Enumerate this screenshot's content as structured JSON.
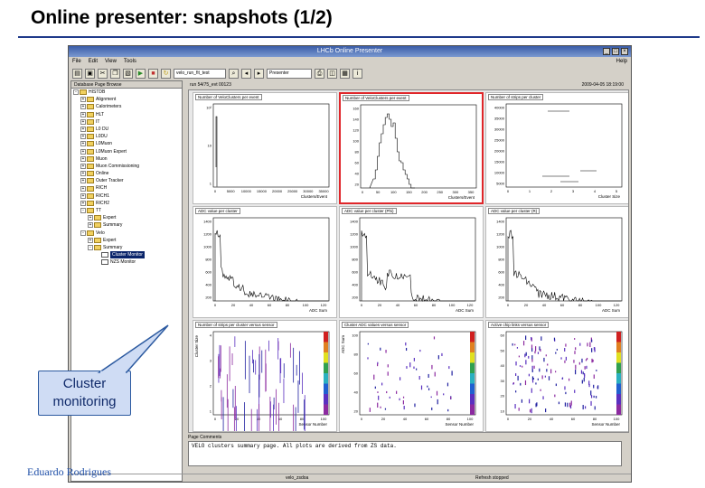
{
  "slide": {
    "title": "Online presenter: snapshots (1/2)",
    "callout": "Cluster monitoring",
    "footer": "Eduardo Rodrigues"
  },
  "window": {
    "title": "LHCb Online Presenter",
    "menu": [
      "File",
      "Edit",
      "View",
      "Tools"
    ],
    "help": "Help",
    "toolbar": {
      "partition_combo": "velo_run_fit_test",
      "mode_combo": "Presenter"
    },
    "info_left": "run 54/75_evt 00123",
    "info_right": "2009-04-05 18:19:00"
  },
  "tree": {
    "header": "Database Page Browse",
    "items": [
      {
        "label": "HISTDB",
        "exp": "-",
        "icon": "folder"
      },
      {
        "label": "Alignment",
        "exp": "+",
        "icon": "folder"
      },
      {
        "label": "Calorimeters",
        "exp": "+",
        "icon": "folder"
      },
      {
        "label": "HLT",
        "exp": "+",
        "icon": "folder"
      },
      {
        "label": "IT",
        "exp": "+",
        "icon": "folder"
      },
      {
        "label": "L0 DU",
        "exp": "+",
        "icon": "folder"
      },
      {
        "label": "L0DU",
        "exp": "+",
        "icon": "folder"
      },
      {
        "label": "L0Muon",
        "exp": "+",
        "icon": "folder"
      },
      {
        "label": "L0Muon Expert",
        "exp": "+",
        "icon": "folder"
      },
      {
        "label": "Muon",
        "exp": "+",
        "icon": "folder"
      },
      {
        "label": "Muon Commissioning",
        "exp": "+",
        "icon": "folder"
      },
      {
        "label": "Online",
        "exp": "+",
        "icon": "folder"
      },
      {
        "label": "Outer Tracker",
        "exp": "+",
        "icon": "folder"
      },
      {
        "label": "RICH",
        "exp": "+",
        "icon": "folder"
      },
      {
        "label": "RICH1",
        "exp": "+",
        "icon": "folder"
      },
      {
        "label": "RICH2",
        "exp": "+",
        "icon": "folder"
      },
      {
        "label": "TT",
        "exp": "-",
        "icon": "folder"
      },
      {
        "label": "Expert",
        "exp": "+",
        "icon": "folder"
      },
      {
        "label": "Summary",
        "exp": "+",
        "icon": "folder"
      },
      {
        "label": "Velo",
        "exp": "-",
        "icon": "folder"
      },
      {
        "label": "Expert",
        "exp": "+",
        "icon": "folder"
      },
      {
        "label": "Summary",
        "exp": "-",
        "icon": "folder"
      },
      {
        "label": "Cluster Monitor",
        "exp": "",
        "icon": "hist",
        "selected": true
      },
      {
        "label": "NZS Monitor",
        "exp": "",
        "icon": "hist"
      }
    ]
  },
  "plots": [
    {
      "title": "Number of VeloClusters per event",
      "xlabel": "Clusters/Event",
      "yticks": [
        "10²",
        "10",
        "1"
      ],
      "xticks": [
        "0",
        "5000",
        "10000",
        "15000",
        "20000",
        "25000",
        "30000",
        "35000"
      ],
      "highlighted": false
    },
    {
      "title": "Number of VeloClusters per event",
      "xlabel": "Clusters/Event",
      "yticks": [
        "160",
        "140",
        "120",
        "100",
        "80",
        "60",
        "40",
        "20"
      ],
      "xticks": [
        "0",
        "50",
        "100",
        "150",
        "200",
        "250",
        "300",
        "350"
      ],
      "highlighted": true
    },
    {
      "title": "Number of strips per cluster",
      "xlabel": "Cluster Size",
      "yticks": [
        "40000",
        "35000",
        "30000",
        "25000",
        "20000",
        "15000",
        "10000",
        "5000"
      ],
      "xticks": [
        "0",
        "1",
        "2",
        "3",
        "4",
        "5"
      ],
      "highlighted": false
    },
    {
      "title": "ADC value per cluster",
      "xlabel": "ADC Sum",
      "yticks": [
        "1400",
        "1200",
        "1000",
        "800",
        "600",
        "400",
        "200"
      ],
      "xticks": [
        "0",
        "20",
        "40",
        "60",
        "80",
        "100",
        "120"
      ],
      "highlighted": false
    },
    {
      "title": "ADC value per cluster (Phi)",
      "xlabel": "ADC Sum",
      "yticks": [
        "1400",
        "1200",
        "1000",
        "800",
        "600",
        "400",
        "200"
      ],
      "xticks": [
        "0",
        "20",
        "40",
        "60",
        "80",
        "100",
        "120"
      ],
      "highlighted": false
    },
    {
      "title": "ADC value per cluster (R)",
      "xlabel": "ADC Sum",
      "yticks": [
        "1400",
        "1200",
        "1000",
        "800",
        "600",
        "400",
        "200"
      ],
      "xticks": [
        "0",
        "20",
        "40",
        "60",
        "80",
        "100",
        "120"
      ],
      "highlighted": false
    },
    {
      "title": "Number of strips per cluster versus sensor",
      "xlabel": "Sensor Number",
      "ylabel": "Cluster Size",
      "yticks": [
        "4",
        "3",
        "2",
        "1"
      ],
      "xticks": [
        "0",
        "20",
        "40",
        "60",
        "80",
        "100"
      ],
      "highlighted": false
    },
    {
      "title": "Cluster ADC values versus sensor",
      "xlabel": "Sensor Number",
      "ylabel": "ADC Sum",
      "yticks": [
        "100",
        "80",
        "60",
        "40",
        "20"
      ],
      "xticks": [
        "0",
        "20",
        "40",
        "60",
        "80",
        "100"
      ],
      "highlighted": false
    },
    {
      "title": "Active chip links versus sensor",
      "xlabel": "Sensor Number",
      "yticks": [
        "60",
        "50",
        "40",
        "30",
        "20",
        "10"
      ],
      "xticks": [
        "0",
        "20",
        "40",
        "60",
        "80",
        "100"
      ],
      "highlighted": false
    }
  ],
  "comments": {
    "label": "Page Comments",
    "text": "VELO clusters summary page. All plots are derived from ZS data."
  },
  "status": {
    "left": "velo_zsdoa",
    "right": "Refresh stopped"
  },
  "colors": {
    "highlight": "#e0262a",
    "callout_fill": "#cfdcf4",
    "callout_border": "#2c5aa0"
  }
}
